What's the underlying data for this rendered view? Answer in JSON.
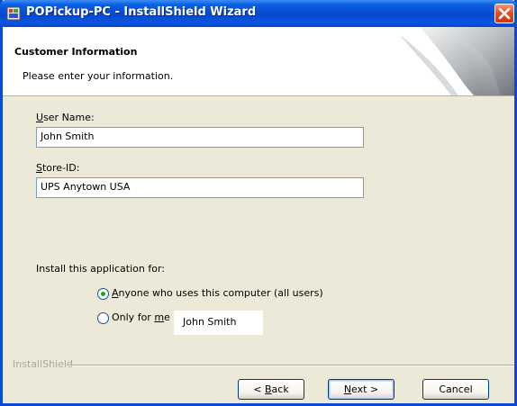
{
  "window": {
    "title": "POPickup-PC - InstallShield Wizard"
  },
  "header": {
    "title": "Customer Information",
    "subtitle": "Please enter your information."
  },
  "form": {
    "user_name": {
      "label_prefix": "",
      "label_mnemonic": "U",
      "label_suffix": "ser Name:",
      "value": "John Smith"
    },
    "store_id": {
      "label_prefix": "",
      "label_mnemonic": "S",
      "label_suffix": "tore-ID:",
      "value": "UPS Anytown USA"
    },
    "install_for": {
      "label": "Install this application for:",
      "options": [
        {
          "prefix": "",
          "mnemonic": "A",
          "suffix": "nyone who uses this computer (all users)",
          "selected": true
        },
        {
          "prefix": "Only for ",
          "mnemonic": "m",
          "suffix": "e (",
          "selected": false
        }
      ]
    },
    "tooltip": "John Smith"
  },
  "footer": {
    "brand": "InstallShield",
    "back": {
      "prefix": "< ",
      "mnemonic": "B",
      "suffix": "ack"
    },
    "next": {
      "prefix": "",
      "mnemonic": "N",
      "suffix": "ext >"
    },
    "cancel": "Cancel"
  },
  "colors": {
    "titlebar": "#0648d0",
    "dialog_bg": "#ece9d8",
    "close_button": "#e0502a",
    "radio_dot": "#21a121"
  }
}
